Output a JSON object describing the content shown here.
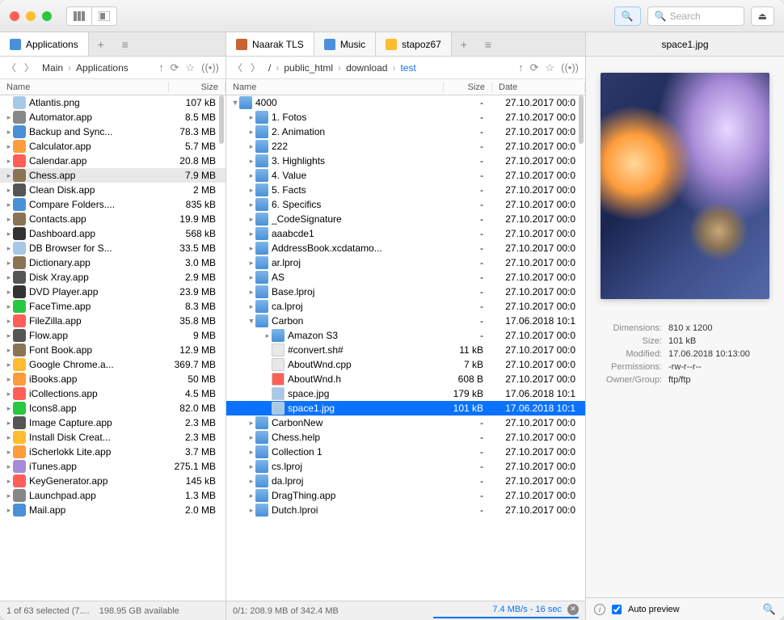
{
  "toolbar": {
    "search_placeholder": "Search"
  },
  "left": {
    "tab": {
      "label": "Applications"
    },
    "breadcrumb": [
      "Main",
      "Applications"
    ],
    "columns": [
      "Name",
      "Size"
    ],
    "rows": [
      {
        "name": "Atlantis.png",
        "size": "107 kB",
        "icon": "#a8c8e8",
        "disc": ""
      },
      {
        "name": "Automator.app",
        "size": "8.5 MB",
        "icon": "#888",
        "disc": "▸"
      },
      {
        "name": "Backup and Sync...",
        "size": "78.3 MB",
        "icon": "#4a90d9",
        "disc": "▸"
      },
      {
        "name": "Calculator.app",
        "size": "5.7 MB",
        "icon": "#ff9d3c",
        "disc": "▸"
      },
      {
        "name": "Calendar.app",
        "size": "20.8 MB",
        "icon": "#ff5f57",
        "disc": "▸"
      },
      {
        "name": "Chess.app",
        "size": "7.9 MB",
        "icon": "#8b7355",
        "disc": "▸",
        "sel": true
      },
      {
        "name": "Clean Disk.app",
        "size": "2 MB",
        "icon": "#555",
        "disc": "▸"
      },
      {
        "name": "Compare Folders....",
        "size": "835 kB",
        "icon": "#4a90d9",
        "disc": "▸"
      },
      {
        "name": "Contacts.app",
        "size": "19.9 MB",
        "icon": "#8b7355",
        "disc": "▸"
      },
      {
        "name": "Dashboard.app",
        "size": "568 kB",
        "icon": "#333",
        "disc": "▸"
      },
      {
        "name": "DB Browser for S...",
        "size": "33.5 MB",
        "icon": "#a8c8e8",
        "disc": "▸"
      },
      {
        "name": "Dictionary.app",
        "size": "3.0 MB",
        "icon": "#8b7355",
        "disc": "▸"
      },
      {
        "name": "Disk Xray.app",
        "size": "2.9 MB",
        "icon": "#555",
        "disc": "▸"
      },
      {
        "name": "DVD Player.app",
        "size": "23.9 MB",
        "icon": "#333",
        "disc": "▸"
      },
      {
        "name": "FaceTime.app",
        "size": "8.3 MB",
        "icon": "#28c840",
        "disc": "▸"
      },
      {
        "name": "FileZilla.app",
        "size": "35.8 MB",
        "icon": "#ff5f57",
        "disc": "▸"
      },
      {
        "name": "Flow.app",
        "size": "9 MB",
        "icon": "#555",
        "disc": "▸"
      },
      {
        "name": "Font Book.app",
        "size": "12.9 MB",
        "icon": "#8b7355",
        "disc": "▸"
      },
      {
        "name": "Google Chrome.a...",
        "size": "369.7 MB",
        "icon": "#febc2e",
        "disc": "▸"
      },
      {
        "name": "iBooks.app",
        "size": "50 MB",
        "icon": "#ff9d3c",
        "disc": "▸"
      },
      {
        "name": "iCollections.app",
        "size": "4.5 MB",
        "icon": "#ff5f57",
        "disc": "▸"
      },
      {
        "name": "Icons8.app",
        "size": "82.0 MB",
        "icon": "#28c840",
        "disc": "▸"
      },
      {
        "name": "Image Capture.app",
        "size": "2.3 MB",
        "icon": "#555",
        "disc": "▸"
      },
      {
        "name": "Install Disk Creat...",
        "size": "2.3 MB",
        "icon": "#febc2e",
        "disc": "▸"
      },
      {
        "name": "iScherlokk Lite.app",
        "size": "3.7 MB",
        "icon": "#ff9d3c",
        "disc": "▸"
      },
      {
        "name": "iTunes.app",
        "size": "275.1 MB",
        "icon": "#a88bd8",
        "disc": "▸"
      },
      {
        "name": "KeyGenerator.app",
        "size": "145 kB",
        "icon": "#ff5f57",
        "disc": "▸"
      },
      {
        "name": "Launchpad.app",
        "size": "1.3 MB",
        "icon": "#888",
        "disc": "▸"
      },
      {
        "name": "Mail.app",
        "size": "2.0 MB",
        "icon": "#4a90d9",
        "disc": "▸"
      }
    ],
    "status": {
      "sel": "1 of 63 selected (7....",
      "free": "198.95 GB available"
    }
  },
  "mid": {
    "tabs": [
      {
        "label": "Naarak TLS",
        "icon": "#c86432",
        "active": true
      },
      {
        "label": "Music",
        "icon": "#4a90d9"
      },
      {
        "label": "stapoz67",
        "icon": "#febc2e"
      }
    ],
    "breadcrumb": [
      "/",
      "public_html",
      "download",
      "test"
    ],
    "columns": [
      "Name",
      "Size",
      "Date"
    ],
    "rows": [
      {
        "name": "4000",
        "size": "-",
        "date": "27.10.2017 00:0",
        "folder": true,
        "disc": "▼",
        "indent": 0
      },
      {
        "name": "1. Fotos",
        "size": "-",
        "date": "27.10.2017 00:0",
        "folder": true,
        "disc": "▸",
        "indent": 1
      },
      {
        "name": "2. Animation",
        "size": "-",
        "date": "27.10.2017 00:0",
        "folder": true,
        "disc": "▸",
        "indent": 1
      },
      {
        "name": "222",
        "size": "-",
        "date": "27.10.2017 00:0",
        "folder": true,
        "disc": "▸",
        "indent": 1
      },
      {
        "name": "3. Highlights",
        "size": "-",
        "date": "27.10.2017 00:0",
        "folder": true,
        "disc": "▸",
        "indent": 1
      },
      {
        "name": "4. Value",
        "size": "-",
        "date": "27.10.2017 00:0",
        "folder": true,
        "disc": "▸",
        "indent": 1
      },
      {
        "name": "5. Facts",
        "size": "-",
        "date": "27.10.2017 00:0",
        "folder": true,
        "disc": "▸",
        "indent": 1
      },
      {
        "name": "6. Specifics",
        "size": "-",
        "date": "27.10.2017 00:0",
        "folder": true,
        "disc": "▸",
        "indent": 1
      },
      {
        "name": "_CodeSignature",
        "size": "-",
        "date": "27.10.2017 00:0",
        "folder": true,
        "disc": "▸",
        "indent": 1
      },
      {
        "name": "aaabcde1",
        "size": "-",
        "date": "27.10.2017 00:0",
        "folder": true,
        "disc": "▸",
        "indent": 1
      },
      {
        "name": "AddressBook.xcdatamo...",
        "size": "-",
        "date": "27.10.2017 00:0",
        "folder": true,
        "disc": "▸",
        "indent": 1
      },
      {
        "name": "ar.lproj",
        "size": "-",
        "date": "27.10.2017 00:0",
        "folder": true,
        "disc": "▸",
        "indent": 1
      },
      {
        "name": "AS",
        "size": "-",
        "date": "27.10.2017 00:0",
        "folder": true,
        "disc": "▸",
        "indent": 1
      },
      {
        "name": "Base.lproj",
        "size": "-",
        "date": "27.10.2017 00:0",
        "folder": true,
        "disc": "▸",
        "indent": 1
      },
      {
        "name": "ca.lproj",
        "size": "-",
        "date": "27.10.2017 00:0",
        "folder": true,
        "disc": "▸",
        "indent": 1
      },
      {
        "name": "Carbon",
        "size": "-",
        "date": "17.06.2018 10:1",
        "folder": true,
        "disc": "▼",
        "indent": 1
      },
      {
        "name": "Amazon S3",
        "size": "-",
        "date": "27.10.2017 00:0",
        "folder": true,
        "disc": "▸",
        "indent": 2
      },
      {
        "name": "#convert.sh#",
        "size": "11 kB",
        "date": "27.10.2017 00:0",
        "folder": false,
        "disc": "",
        "indent": 2,
        "ic": "#e8e8e8"
      },
      {
        "name": "AboutWnd.cpp",
        "size": "7 kB",
        "date": "27.10.2017 00:0",
        "folder": false,
        "disc": "",
        "indent": 2,
        "ic": "#e8e8e8"
      },
      {
        "name": "AboutWnd.h",
        "size": "608 B",
        "date": "27.10.2017 00:0",
        "folder": false,
        "disc": "",
        "indent": 2,
        "ic": "#ff5f57"
      },
      {
        "name": "space.jpg",
        "size": "179 kB",
        "date": "17.06.2018 10:1",
        "folder": false,
        "disc": "",
        "indent": 2,
        "ic": "#a8c8e8"
      },
      {
        "name": "space1.jpg",
        "size": "101 kB",
        "date": "17.06.2018 10:1",
        "folder": false,
        "disc": "",
        "indent": 2,
        "ic": "#a8c8e8",
        "sel": true
      },
      {
        "name": "CarbonNew",
        "size": "-",
        "date": "27.10.2017 00:0",
        "folder": true,
        "disc": "▸",
        "indent": 1
      },
      {
        "name": "Chess.help",
        "size": "-",
        "date": "27.10.2017 00:0",
        "folder": true,
        "disc": "▸",
        "indent": 1
      },
      {
        "name": "Collection 1",
        "size": "-",
        "date": "27.10.2017 00:0",
        "folder": true,
        "disc": "▸",
        "indent": 1
      },
      {
        "name": "cs.lproj",
        "size": "-",
        "date": "27.10.2017 00:0",
        "folder": true,
        "disc": "▸",
        "indent": 1
      },
      {
        "name": "da.lproj",
        "size": "-",
        "date": "27.10.2017 00:0",
        "folder": true,
        "disc": "▸",
        "indent": 1
      },
      {
        "name": "DragThing.app",
        "size": "-",
        "date": "27.10.2017 00:0",
        "folder": true,
        "disc": "▸",
        "indent": 1
      },
      {
        "name": "Dutch.lproi",
        "size": "-",
        "date": "27.10.2017 00:0",
        "folder": true,
        "disc": "▸",
        "indent": 1
      }
    ],
    "status": {
      "sel": "0/1: 208.9 MB of 342.4 MB",
      "speed": "7.4 MB/s - 16 sec"
    }
  },
  "right": {
    "title": "space1.jpg",
    "meta": [
      {
        "k": "Dimensions:",
        "v": "810 x 1200"
      },
      {
        "k": "Size:",
        "v": "101 kB"
      },
      {
        "k": "Modified:",
        "v": "17.06.2018 10:13:00"
      },
      {
        "k": "Permissions:",
        "v": "-rw-r--r--"
      },
      {
        "k": "Owner/Group:",
        "v": "ftp/ftp"
      }
    ],
    "auto_preview": "Auto preview"
  }
}
